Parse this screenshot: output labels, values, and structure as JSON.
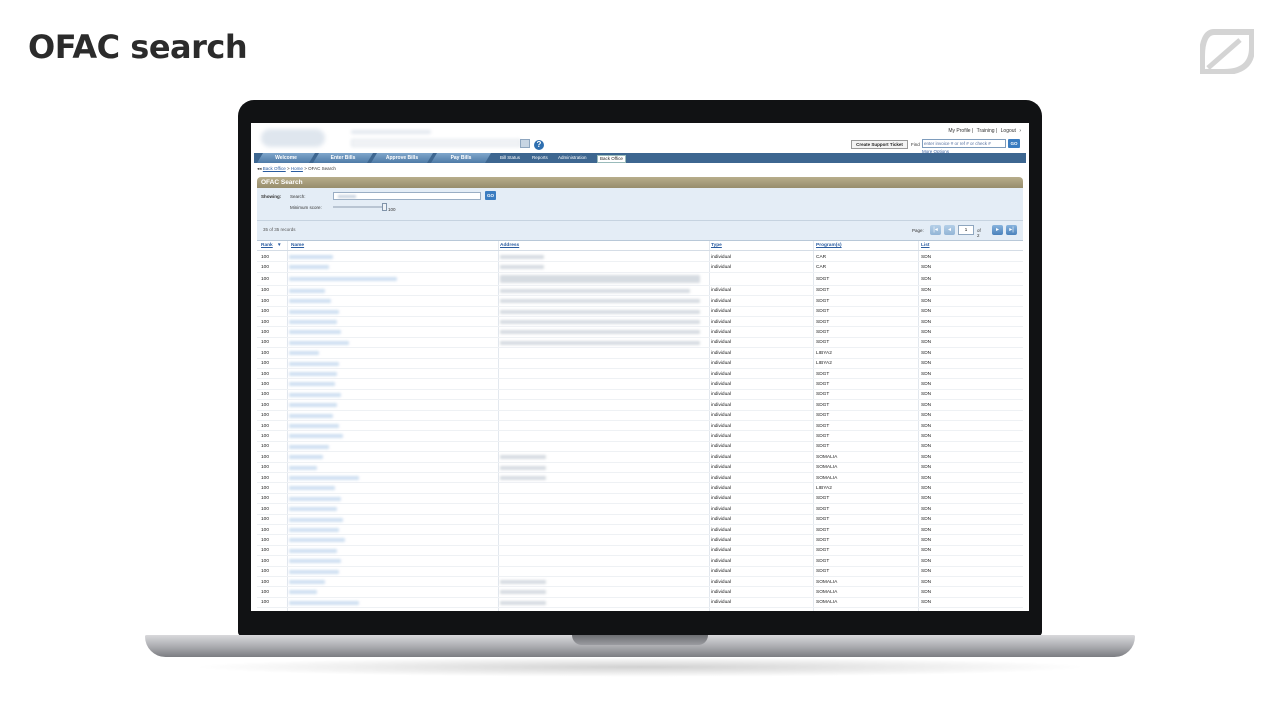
{
  "slide": {
    "title": "OFAC search"
  },
  "app": {
    "top_links": [
      "My Profile",
      "Training",
      "Logout"
    ],
    "support_button": "Create Support Ticket",
    "find_label": "Find",
    "find_placeholder": "enter invoice # or ref # or check #",
    "find_go": "GO",
    "more_options": "More Options",
    "help": "?"
  },
  "nav": {
    "tabs": [
      "Welcome",
      "Enter Bills",
      "Approve Bills",
      "Pay Bills"
    ],
    "links": [
      "Bill Status",
      "Reports",
      "Administration",
      "Back Office"
    ]
  },
  "breadcrumb": {
    "back": "Back Office",
    "home": "Home",
    "current": "OFAC Search",
    "sep": ">"
  },
  "panel": {
    "title": "OFAC Search",
    "showing_label": "Showing:",
    "search_label": "Search:",
    "go": "GO",
    "min_score_label": "Minimum score:",
    "min_score_value": "100",
    "records": "35 of 35 records",
    "page_label": "Page:",
    "page_value": "1",
    "page_total": "of 2"
  },
  "table": {
    "headers": {
      "rank": "Rank",
      "name": "Name",
      "address": "Address",
      "type": "Type",
      "programs": "Program(s)",
      "list": "List"
    },
    "rows": [
      {
        "rank": "100",
        "type": "individual",
        "program": "CAR",
        "list": "SDN"
      },
      {
        "rank": "100",
        "type": "individual",
        "program": "CAR",
        "list": "SDN"
      },
      {
        "rank": "100",
        "type": "",
        "program": "SDGT",
        "list": "SDN"
      },
      {
        "rank": "100",
        "type": "individual",
        "program": "SDGT",
        "list": "SDN"
      },
      {
        "rank": "100",
        "type": "individual",
        "program": "SDGT",
        "list": "SDN"
      },
      {
        "rank": "100",
        "type": "individual",
        "program": "SDGT",
        "list": "SDN"
      },
      {
        "rank": "100",
        "type": "individual",
        "program": "SDGT",
        "list": "SDN"
      },
      {
        "rank": "100",
        "type": "individual",
        "program": "SDGT",
        "list": "SDN"
      },
      {
        "rank": "100",
        "type": "individual",
        "program": "SDGT",
        "list": "SDN"
      },
      {
        "rank": "100",
        "type": "individual",
        "program": "LIBYA2",
        "list": "SDN"
      },
      {
        "rank": "100",
        "type": "individual",
        "program": "LIBYA2",
        "list": "SDN"
      },
      {
        "rank": "100",
        "type": "individual",
        "program": "SDGT",
        "list": "SDN"
      },
      {
        "rank": "100",
        "type": "individual",
        "program": "SDGT",
        "list": "SDN"
      },
      {
        "rank": "100",
        "type": "individual",
        "program": "SDGT",
        "list": "SDN"
      },
      {
        "rank": "100",
        "type": "individual",
        "program": "SDGT",
        "list": "SDN"
      },
      {
        "rank": "100",
        "type": "individual",
        "program": "SDGT",
        "list": "SDN"
      },
      {
        "rank": "100",
        "type": "individual",
        "program": "SDGT",
        "list": "SDN"
      },
      {
        "rank": "100",
        "type": "individual",
        "program": "SDGT",
        "list": "SDN"
      },
      {
        "rank": "100",
        "type": "individual",
        "program": "SDGT",
        "list": "SDN"
      },
      {
        "rank": "100",
        "type": "individual",
        "program": "SOMALIA",
        "list": "SDN"
      },
      {
        "rank": "100",
        "type": "individual",
        "program": "SOMALIA",
        "list": "SDN"
      },
      {
        "rank": "100",
        "type": "individual",
        "program": "SOMALIA",
        "list": "SDN"
      },
      {
        "rank": "100",
        "type": "individual",
        "program": "LIBYA2",
        "list": "SDN"
      },
      {
        "rank": "100",
        "type": "individual",
        "program": "SDGT",
        "list": "SDN"
      },
      {
        "rank": "100",
        "type": "individual",
        "program": "SDGT",
        "list": "SDN"
      },
      {
        "rank": "100",
        "type": "individual",
        "program": "SDGT",
        "list": "SDN"
      },
      {
        "rank": "100",
        "type": "individual",
        "program": "SDGT",
        "list": "SDN"
      },
      {
        "rank": "100",
        "type": "individual",
        "program": "SDGT",
        "list": "SDN"
      },
      {
        "rank": "100",
        "type": "individual",
        "program": "SDGT",
        "list": "SDN"
      },
      {
        "rank": "100",
        "type": "individual",
        "program": "SDGT",
        "list": "SDN"
      },
      {
        "rank": "100",
        "type": "individual",
        "program": "SDGT",
        "list": "SDN"
      },
      {
        "rank": "100",
        "type": "individual",
        "program": "SOMALIA",
        "list": "SDN"
      },
      {
        "rank": "100",
        "type": "individual",
        "program": "SOMALIA",
        "list": "SDN"
      },
      {
        "rank": "100",
        "type": "individual",
        "program": "SOMALIA",
        "list": "SDN"
      }
    ]
  },
  "colors": {
    "nav": "#3d6690",
    "panel_header": "#978d6c",
    "panel_body": "#e4edf6",
    "link": "#2a5ca0"
  }
}
